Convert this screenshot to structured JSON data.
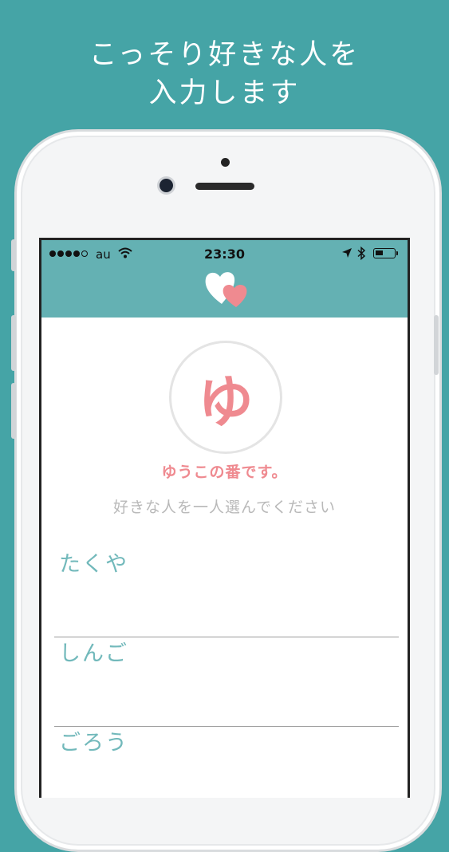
{
  "caption": {
    "line1": "こっそり好きな人を",
    "line2": "入力します"
  },
  "status_bar": {
    "carrier": "au",
    "time": "23:30"
  },
  "icons": {
    "logo": "hearts-logo-icon",
    "wifi": "wifi-icon",
    "location": "location-arrow-icon",
    "bluetooth": "bluetooth-icon",
    "battery": "battery-icon"
  },
  "colors": {
    "background": "#45a4a6",
    "navbar": "#64b1b3",
    "accent_pink": "#ef8a90",
    "list_text": "#72b9bb"
  },
  "player": {
    "avatar_char": "ゆ",
    "turn_text": "ゆうこの番です。",
    "instruction": "好きな人を一人選んでください"
  },
  "people": [
    {
      "name": "たくや"
    },
    {
      "name": "しんご"
    },
    {
      "name": "ごろう"
    }
  ]
}
